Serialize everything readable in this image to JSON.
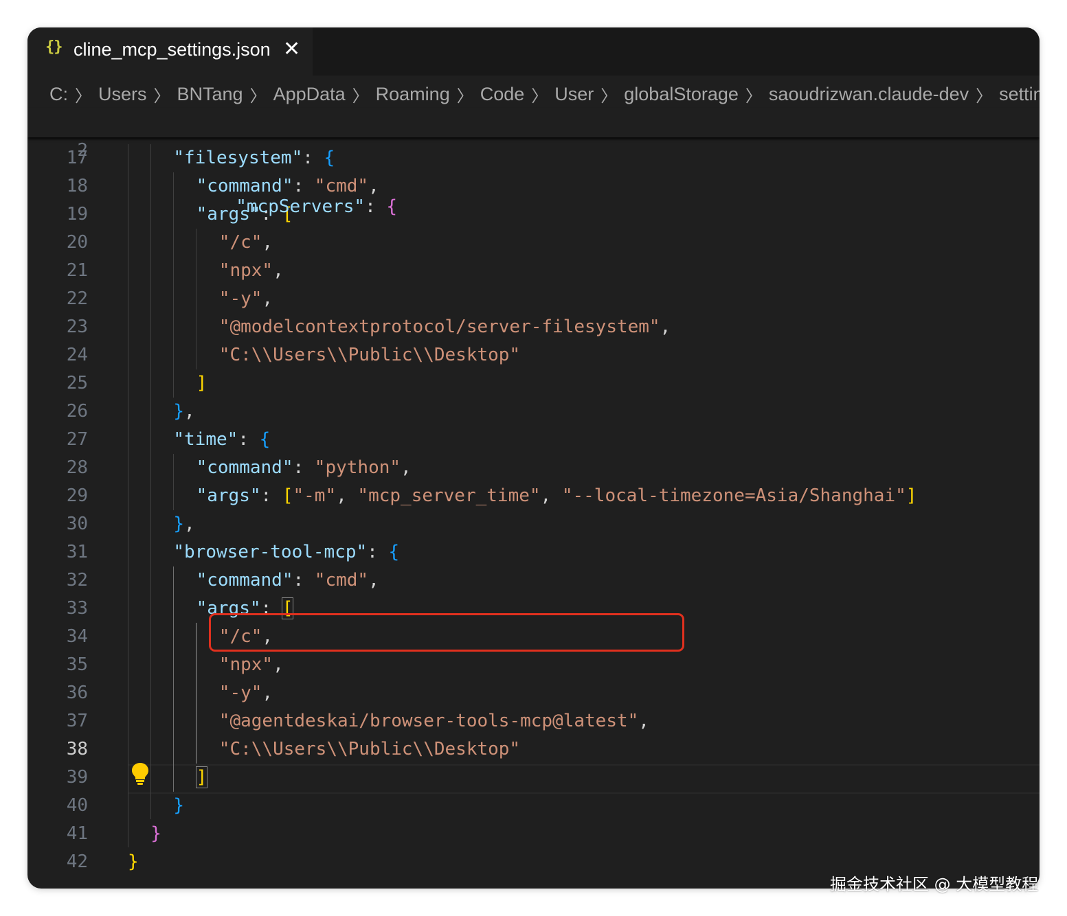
{
  "tab": {
    "icon": "{}",
    "icon_name": "json-file-icon",
    "title": "cline_mcp_settings.json",
    "close": "✕"
  },
  "breadcrumb": [
    "C:",
    "Users",
    "BNTang",
    "AppData",
    "Roaming",
    "Code",
    "User",
    "globalStorage",
    "saoudrizwan.claude-dev",
    "settings"
  ],
  "sticky": {
    "line_number": "2",
    "key": "\"mcpServers\"",
    "colon": ": ",
    "brace": "{"
  },
  "lines": [
    {
      "n": "17",
      "indent": 2,
      "tokens": [
        [
          "k",
          "\"filesystem\""
        ],
        [
          "p",
          ": "
        ],
        [
          "b3",
          "{"
        ]
      ]
    },
    {
      "n": "18",
      "indent": 3,
      "tokens": [
        [
          "k",
          "\"command\""
        ],
        [
          "p",
          ": "
        ],
        [
          "s",
          "\"cmd\""
        ],
        [
          "p",
          ","
        ]
      ]
    },
    {
      "n": "19",
      "indent": 3,
      "tokens": [
        [
          "k",
          "\"args\""
        ],
        [
          "p",
          ": "
        ],
        [
          "b1",
          "["
        ]
      ]
    },
    {
      "n": "20",
      "indent": 4,
      "tokens": [
        [
          "s",
          "\"/c\""
        ],
        [
          "p",
          ","
        ]
      ]
    },
    {
      "n": "21",
      "indent": 4,
      "tokens": [
        [
          "s",
          "\"npx\""
        ],
        [
          "p",
          ","
        ]
      ]
    },
    {
      "n": "22",
      "indent": 4,
      "tokens": [
        [
          "s",
          "\"-y\""
        ],
        [
          "p",
          ","
        ]
      ]
    },
    {
      "n": "23",
      "indent": 4,
      "tokens": [
        [
          "s",
          "\"@modelcontextprotocol/server-filesystem\""
        ],
        [
          "p",
          ","
        ]
      ]
    },
    {
      "n": "24",
      "indent": 4,
      "tokens": [
        [
          "s",
          "\"C:\\\\Users\\\\Public\\\\Desktop\""
        ]
      ]
    },
    {
      "n": "25",
      "indent": 3,
      "tokens": [
        [
          "b1",
          "]"
        ]
      ]
    },
    {
      "n": "26",
      "indent": 2,
      "tokens": [
        [
          "b3",
          "}"
        ],
        [
          "p",
          ","
        ]
      ]
    },
    {
      "n": "27",
      "indent": 2,
      "tokens": [
        [
          "k",
          "\"time\""
        ],
        [
          "p",
          ": "
        ],
        [
          "b3",
          "{"
        ]
      ]
    },
    {
      "n": "28",
      "indent": 3,
      "tokens": [
        [
          "k",
          "\"command\""
        ],
        [
          "p",
          ": "
        ],
        [
          "s",
          "\"python\""
        ],
        [
          "p",
          ","
        ]
      ]
    },
    {
      "n": "29",
      "indent": 3,
      "tokens": [
        [
          "k",
          "\"args\""
        ],
        [
          "p",
          ": "
        ],
        [
          "b1",
          "["
        ],
        [
          "s",
          "\"-m\""
        ],
        [
          "p",
          ", "
        ],
        [
          "s",
          "\"mcp_server_time\""
        ],
        [
          "p",
          ", "
        ],
        [
          "s",
          "\"--local-timezone=Asia/Shanghai\""
        ],
        [
          "b1",
          "]"
        ]
      ]
    },
    {
      "n": "30",
      "indent": 2,
      "tokens": [
        [
          "b3",
          "}"
        ],
        [
          "p",
          ","
        ]
      ]
    },
    {
      "n": "31",
      "indent": 2,
      "tokens": [
        [
          "k",
          "\"browser-tool-mcp\""
        ],
        [
          "p",
          ": "
        ],
        [
          "b3",
          "{"
        ]
      ]
    },
    {
      "n": "32",
      "indent": 3,
      "tokens": [
        [
          "k",
          "\"command\""
        ],
        [
          "p",
          ": "
        ],
        [
          "s",
          "\"cmd\""
        ],
        [
          "p",
          ","
        ]
      ]
    },
    {
      "n": "33",
      "indent": 3,
      "tokens": [
        [
          "k",
          "\"args\""
        ],
        [
          "p",
          ": "
        ],
        [
          "b1box",
          "["
        ]
      ]
    },
    {
      "n": "34",
      "indent": 4,
      "tokens": [
        [
          "s",
          "\"/c\""
        ],
        [
          "p",
          ","
        ]
      ]
    },
    {
      "n": "35",
      "indent": 4,
      "tokens": [
        [
          "s",
          "\"npx\""
        ],
        [
          "p",
          ","
        ]
      ]
    },
    {
      "n": "36",
      "indent": 4,
      "tokens": [
        [
          "s",
          "\"-y\""
        ],
        [
          "p",
          ","
        ]
      ]
    },
    {
      "n": "37",
      "indent": 4,
      "tokens": [
        [
          "s",
          "\"@agentdeskai/browser-tools-mcp@latest\""
        ],
        [
          "p",
          ","
        ]
      ]
    },
    {
      "n": "38",
      "indent": 4,
      "tokens": [
        [
          "s",
          "\"C:\\\\Users\\\\Public\\\\Desktop\""
        ]
      ],
      "active": true
    },
    {
      "n": "39",
      "indent": 3,
      "tokens": [
        [
          "b1box",
          "]"
        ]
      ]
    },
    {
      "n": "40",
      "indent": 2,
      "tokens": [
        [
          "b3",
          "}"
        ]
      ]
    },
    {
      "n": "41",
      "indent": 1,
      "tokens": [
        [
          "b2",
          "}"
        ]
      ]
    },
    {
      "n": "42",
      "indent": 0,
      "tokens": [
        [
          "b1",
          "}"
        ]
      ]
    }
  ],
  "lightbulb_icon": "lightbulb-icon",
  "colors": {
    "key": "#9cdcfe",
    "string": "#ce9178",
    "bracket_gold": "#ffd700",
    "bracket_purple": "#da70d6",
    "bracket_blue": "#179fff",
    "highlight_box": "#e0301e"
  },
  "watermark": "掘金技术社区 @ 大模型教程"
}
